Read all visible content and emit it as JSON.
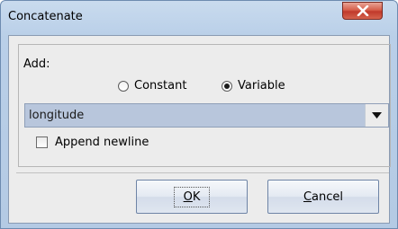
{
  "window": {
    "title": "Concatenate",
    "close_icon": "close-icon"
  },
  "add_section": {
    "label": "Add:",
    "radio_options": [
      {
        "label": "Constant",
        "selected": false
      },
      {
        "label": "Variable",
        "selected": true
      }
    ]
  },
  "variable_select": {
    "value": "longitude",
    "arrow_icon": "chevron-down-icon"
  },
  "append_newline": {
    "label": "Append newline",
    "checked": false
  },
  "buttons": {
    "ok": {
      "mnemonic": "O",
      "rest": "K"
    },
    "cancel": {
      "mnemonic": "C",
      "rest": "ancel"
    }
  },
  "colors": {
    "title_bar": "#c9dbee",
    "close_button": "#c0392b",
    "dialog_background": "#ececec",
    "select_highlight": "#b8c6dc"
  }
}
